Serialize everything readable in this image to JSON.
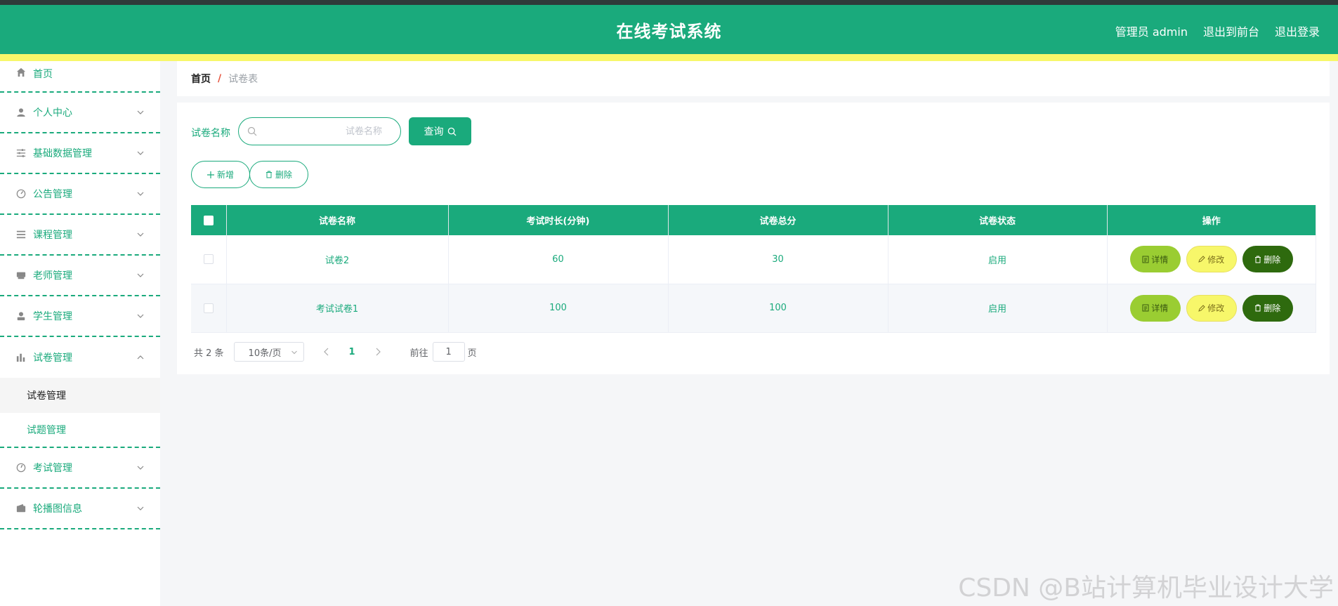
{
  "header": {
    "title": "在线考试系统",
    "user": "管理员 admin",
    "to_front": "退出到前台",
    "logout": "退出登录"
  },
  "sidebar": {
    "items": [
      {
        "label": "首页",
        "icon": "home-icon"
      },
      {
        "label": "个人中心",
        "icon": "user-icon"
      },
      {
        "label": "基础数据管理",
        "icon": "sliders-icon"
      },
      {
        "label": "公告管理",
        "icon": "dashboard-icon"
      },
      {
        "label": "课程管理",
        "icon": "list-icon"
      },
      {
        "label": "老师管理",
        "icon": "desk-icon"
      },
      {
        "label": "学生管理",
        "icon": "student-icon"
      },
      {
        "label": "试卷管理",
        "icon": "bar-chart-icon",
        "sub": [
          "试卷管理",
          "试题管理"
        ]
      },
      {
        "label": "考试管理",
        "icon": "compass-icon"
      },
      {
        "label": "轮播图信息",
        "icon": "wallet-icon"
      }
    ]
  },
  "breadcrumb": {
    "home": "首页",
    "sep": "/",
    "current": "试卷表"
  },
  "search": {
    "label": "试卷名称",
    "placeholder": "试卷名称",
    "button": "查询"
  },
  "actions": {
    "add": "新增",
    "delete": "删除"
  },
  "table": {
    "headers": [
      "试卷名称",
      "考试时长(分钟)",
      "试卷总分",
      "试卷状态",
      "操作"
    ],
    "rows": [
      {
        "name": "试卷2",
        "duration": "60",
        "score": "30",
        "status": "启用"
      },
      {
        "name": "考试试卷1",
        "duration": "100",
        "score": "100",
        "status": "启用"
      }
    ],
    "op_labels": {
      "detail": "详情",
      "edit": "修改",
      "remove": "删除"
    }
  },
  "pagination": {
    "total": "共 2 条",
    "page_size": "10条/页",
    "current_page": "1",
    "goto": "前往",
    "goto_value": "1",
    "page_word": "页"
  },
  "watermark": "CSDN @B站计算机毕业设计大学",
  "colors": {
    "primary": "#1aaa7c",
    "yellow_bar": "#f7f76a",
    "detail": "#9acd32",
    "edit": "#f7f76a",
    "remove": "#2e6a0e"
  }
}
